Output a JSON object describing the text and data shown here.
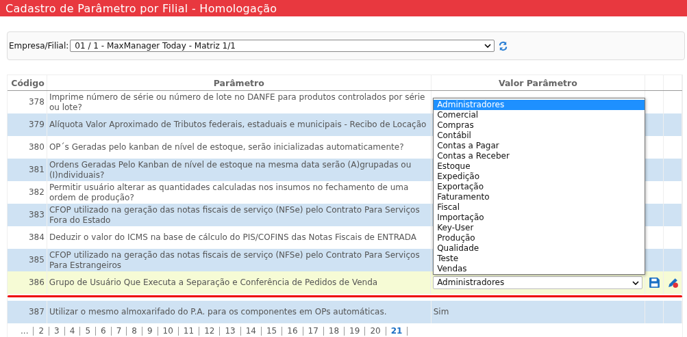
{
  "title": "Cadastro de Parâmetro por Filial  - Homologação",
  "filter": {
    "label": "Empresa/Filial:",
    "value": "01 / 1 - MaxManager Today - Matriz 1/1"
  },
  "table": {
    "columns": [
      "Código",
      "Parâmetro",
      "Valor Parâmetro"
    ],
    "rows": [
      {
        "kind": "view",
        "code": "378",
        "parameter": "Imprime número de série ou número de lote no DANFE para produtos controlados por série ou lote?",
        "value": ""
      },
      {
        "kind": "view",
        "code": "379",
        "parameter": "Alíquota Valor Aproximado de Tributos federais, estaduais e municipais - Recibo de Locação",
        "value": ""
      },
      {
        "kind": "view",
        "code": "380",
        "parameter": "OP´s Geradas pelo kanban de nível de estoque, serão inicializadas automaticamente?",
        "value": ""
      },
      {
        "kind": "view",
        "code": "381",
        "parameter": "Ordens Geradas Pelo Kanban de nível de estoque na mesma data serão (A)grupadas ou (I)ndividuais?",
        "value": ""
      },
      {
        "kind": "view",
        "code": "382",
        "parameter": "Permitir usuário alterar as quantidades calculadas nos insumos no fechamento de uma ordem de produção?",
        "value": ""
      },
      {
        "kind": "view",
        "code": "383",
        "parameter": "CFOP utilizado na geração das notas fiscais de serviço (NFSe) pelo Contrato Para Serviços Fora do Estado",
        "value": ""
      },
      {
        "kind": "view",
        "code": "384",
        "parameter": "Deduzir o valor do ICMS na base de cálculo do PIS/COFINS das Notas Fiscais de ENTRADA",
        "value": ""
      },
      {
        "kind": "view",
        "code": "385",
        "parameter": "CFOP utilizado na geração das notas fiscais de serviço (NFSe) pelo Contrato Para Serviços Para Estrangeiros",
        "value": ""
      },
      {
        "kind": "edit",
        "code": "386",
        "parameter": "Grupo de Usuário Que Executa a Separação e Conferência de Pedidos de Venda",
        "value": "Administradores",
        "expanded": true,
        "options": [
          {
            "label": "Administradores",
            "selected": true
          },
          {
            "label": "Comercial",
            "selected": false
          },
          {
            "label": "Compras",
            "selected": false
          },
          {
            "label": "Contábil",
            "selected": false
          },
          {
            "label": "Contas a Pagar",
            "selected": false
          },
          {
            "label": "Contas a Receber",
            "selected": false
          },
          {
            "label": "Estoque",
            "selected": false
          },
          {
            "label": "Expedição",
            "selected": false
          },
          {
            "label": "Exportação",
            "selected": false
          },
          {
            "label": "Faturamento",
            "selected": false
          },
          {
            "label": "Fiscal",
            "selected": false
          },
          {
            "label": "Importação",
            "selected": false
          },
          {
            "label": "Key-User",
            "selected": false
          },
          {
            "label": "Produção",
            "selected": false
          },
          {
            "label": "Qualidade",
            "selected": false
          },
          {
            "label": "Teste",
            "selected": false
          },
          {
            "label": "Vendas",
            "selected": false
          }
        ]
      },
      {
        "kind": "view",
        "code": "387",
        "parameter": "Utilizar o mesmo almoxarifado do P.A. para os componentes em OPs automáticas.",
        "value": "Sim"
      }
    ]
  },
  "pagination": [
    {
      "label": "...",
      "selected": false
    },
    {
      "label": "2",
      "selected": false
    },
    {
      "label": "3",
      "selected": false
    },
    {
      "label": "4",
      "selected": false
    },
    {
      "label": "5",
      "selected": false
    },
    {
      "label": "6",
      "selected": false
    },
    {
      "label": "7",
      "selected": false
    },
    {
      "label": "8",
      "selected": false
    },
    {
      "label": "9",
      "selected": false
    },
    {
      "label": "10",
      "selected": false
    },
    {
      "label": "11",
      "selected": false
    },
    {
      "label": "12",
      "selected": false
    },
    {
      "label": "13",
      "selected": false
    },
    {
      "label": "14",
      "selected": false
    },
    {
      "label": "15",
      "selected": false
    },
    {
      "label": "16",
      "selected": false
    },
    {
      "label": "17",
      "selected": false
    },
    {
      "label": "18",
      "selected": false
    },
    {
      "label": "19",
      "selected": false
    },
    {
      "label": "20",
      "selected": false
    },
    {
      "label": "21",
      "selected": true
    }
  ]
}
